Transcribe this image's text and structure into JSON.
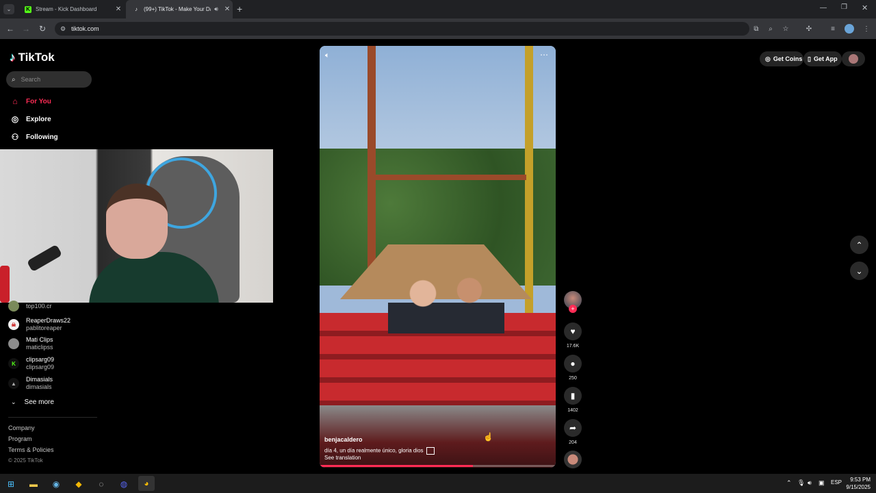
{
  "browser": {
    "tabs": [
      {
        "label": "Stream - Kick Dashboard",
        "favicon": "K"
      },
      {
        "label": "(99+) TikTok - Make Your Da"
      }
    ],
    "url": "tiktok.com"
  },
  "tiktok": {
    "logo_text": "TikTok",
    "search_placeholder": "Search",
    "nav": [
      {
        "label": "For You",
        "active": true,
        "icon": "home-icon"
      },
      {
        "label": "Explore",
        "icon": "compass-icon"
      },
      {
        "label": "Following",
        "icon": "following-icon"
      }
    ],
    "accounts": [
      {
        "name": "top100.cr",
        "handle": ""
      },
      {
        "name": "ReaperDraws22",
        "handle": "pablitoreaper"
      },
      {
        "name": "Mati Clips",
        "handle": "maticlipss"
      },
      {
        "name": "clipsarg09",
        "handle": "clipsarg09"
      },
      {
        "name": "Dimasials",
        "handle": "dimasials"
      }
    ],
    "see_more": "See more",
    "footer": [
      "Company",
      "Program",
      "Terms & Policies"
    ],
    "copyright": "© 2025 TikTok",
    "header_buttons": {
      "coins": "Get Coins",
      "app": "Get App"
    },
    "video": {
      "author": "benjacaldero",
      "caption": "día 4, un día realmente único, gloria dios",
      "translation": "See translation",
      "progress": 0.65
    },
    "stats": {
      "likes": "17.6K",
      "comments": "250",
      "saves": "1402",
      "shares": "204"
    }
  },
  "taskbar": {
    "language": "ESP",
    "time": "9:53 PM",
    "date": "9/15/2025"
  },
  "colors": {
    "accent": "#fe2c55",
    "kick": "#53fc18"
  }
}
